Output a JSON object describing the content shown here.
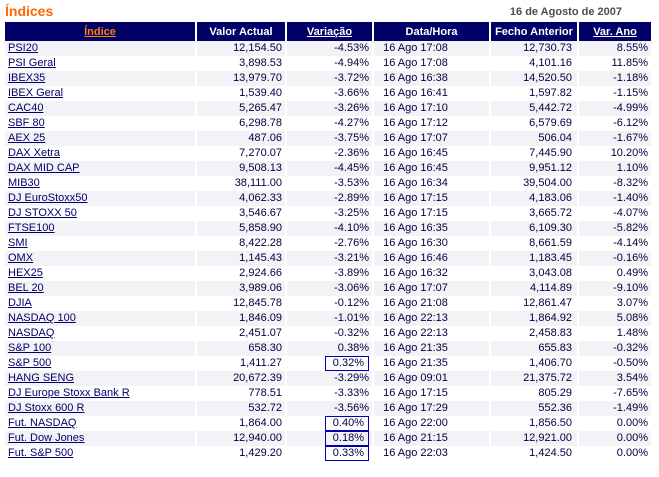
{
  "page": {
    "title": "Índices",
    "date": "16 de Agosto de 2007"
  },
  "colors": {
    "title_orange": "#FF6600",
    "header_bg": "#000066",
    "header_text": "#FFFFFF",
    "header_sort_link_orange": "#FF8000",
    "row_stripe": "#F2F2F7",
    "row_plain": "#FFFFFF",
    "cell_text": "#000040",
    "index_link": "#000066",
    "highlight_box_border": "#0000B0",
    "date_text": "#4D4D4D"
  },
  "table": {
    "columns": [
      "Índice",
      "Valor Actual",
      "Variação",
      "Data/Hora",
      "Fecho Anterior",
      "Var. Ano"
    ],
    "rows": [
      {
        "index": "PSI20",
        "valor_actual": "12,154.50",
        "variacao": "-4.53%",
        "data_hora": "16 Ago 17:08",
        "fecho_anterior": "12,730.73",
        "var_ano": "8.55%",
        "variacao_boxed": false
      },
      {
        "index": "PSI Geral",
        "valor_actual": "3,898.53",
        "variacao": "-4.94%",
        "data_hora": "16 Ago 17:08",
        "fecho_anterior": "4,101.16",
        "var_ano": "11.85%",
        "variacao_boxed": false
      },
      {
        "index": "IBEX35",
        "valor_actual": "13,979.70",
        "variacao": "-3.72%",
        "data_hora": "16 Ago 16:38",
        "fecho_anterior": "14,520.50",
        "var_ano": "-1.18%",
        "variacao_boxed": false
      },
      {
        "index": "IBEX Geral",
        "valor_actual": "1,539.40",
        "variacao": "-3.66%",
        "data_hora": "16 Ago 16:41",
        "fecho_anterior": "1,597.82",
        "var_ano": "-1.15%",
        "variacao_boxed": false
      },
      {
        "index": "CAC40",
        "valor_actual": "5,265.47",
        "variacao": "-3.26%",
        "data_hora": "16 Ago 17:10",
        "fecho_anterior": "5,442.72",
        "var_ano": "-4.99%",
        "variacao_boxed": false
      },
      {
        "index": "SBF 80",
        "valor_actual": "6,298.78",
        "variacao": "-4.27%",
        "data_hora": "16 Ago 17:12",
        "fecho_anterior": "6,579.69",
        "var_ano": "-6.12%",
        "variacao_boxed": false
      },
      {
        "index": "AEX 25",
        "valor_actual": "487.06",
        "variacao": "-3.75%",
        "data_hora": "16 Ago 17:07",
        "fecho_anterior": "506.04",
        "var_ano": "-1.67%",
        "variacao_boxed": false
      },
      {
        "index": "DAX Xetra",
        "valor_actual": "7,270.07",
        "variacao": "-2.36%",
        "data_hora": "16 Ago 16:45",
        "fecho_anterior": "7,445.90",
        "var_ano": "10.20%",
        "variacao_boxed": false
      },
      {
        "index": "DAX MID CAP",
        "valor_actual": "9,508.13",
        "variacao": "-4.45%",
        "data_hora": "16 Ago 16:45",
        "fecho_anterior": "9,951.12",
        "var_ano": "1.10%",
        "variacao_boxed": false
      },
      {
        "index": "MIB30",
        "valor_actual": "38,111.00",
        "variacao": "-3.53%",
        "data_hora": "16 Ago 16:34",
        "fecho_anterior": "39,504.00",
        "var_ano": "-8.32%",
        "variacao_boxed": false
      },
      {
        "index": "DJ EuroStoxx50",
        "valor_actual": "4,062.33",
        "variacao": "-2.89%",
        "data_hora": "16 Ago 17:15",
        "fecho_anterior": "4,183.06",
        "var_ano": "-1.40%",
        "variacao_boxed": false
      },
      {
        "index": "DJ STOXX 50",
        "valor_actual": "3,546.67",
        "variacao": "-3.25%",
        "data_hora": "16 Ago 17:15",
        "fecho_anterior": "3,665.72",
        "var_ano": "-4.07%",
        "variacao_boxed": false
      },
      {
        "index": "FTSE100",
        "valor_actual": "5,858.90",
        "variacao": "-4.10%",
        "data_hora": "16 Ago 16:35",
        "fecho_anterior": "6,109.30",
        "var_ano": "-5.82%",
        "variacao_boxed": false
      },
      {
        "index": "SMI",
        "valor_actual": "8,422.28",
        "variacao": "-2.76%",
        "data_hora": "16 Ago 16:30",
        "fecho_anterior": "8,661.59",
        "var_ano": "-4.14%",
        "variacao_boxed": false
      },
      {
        "index": "OMX",
        "valor_actual": "1,145.43",
        "variacao": "-3.21%",
        "data_hora": "16 Ago 16:46",
        "fecho_anterior": "1,183.45",
        "var_ano": "-0.16%",
        "variacao_boxed": false
      },
      {
        "index": "HEX25",
        "valor_actual": "2,924.66",
        "variacao": "-3.89%",
        "data_hora": "16 Ago 16:32",
        "fecho_anterior": "3,043.08",
        "var_ano": "0.49%",
        "variacao_boxed": false
      },
      {
        "index": "BEL 20",
        "valor_actual": "3,989.06",
        "variacao": "-3.06%",
        "data_hora": "16 Ago 17:07",
        "fecho_anterior": "4,114.89",
        "var_ano": "-9.10%",
        "variacao_boxed": false
      },
      {
        "index": "DJIA",
        "valor_actual": "12,845.78",
        "variacao": "-0.12%",
        "data_hora": "16 Ago 21:08",
        "fecho_anterior": "12,861.47",
        "var_ano": "3.07%",
        "variacao_boxed": false
      },
      {
        "index": "NASDAQ 100",
        "valor_actual": "1,846.09",
        "variacao": "-1.01%",
        "data_hora": "16 Ago 22:13",
        "fecho_anterior": "1,864.92",
        "var_ano": "5.08%",
        "variacao_boxed": false
      },
      {
        "index": "NASDAQ",
        "valor_actual": "2,451.07",
        "variacao": "-0.32%",
        "data_hora": "16 Ago 22:13",
        "fecho_anterior": "2,458.83",
        "var_ano": "1.48%",
        "variacao_boxed": false
      },
      {
        "index": "S&P 100",
        "valor_actual": "658.30",
        "variacao": "0.38%",
        "data_hora": "16 Ago 21:35",
        "fecho_anterior": "655.83",
        "var_ano": "-0.32%",
        "variacao_boxed": false
      },
      {
        "index": "S&P 500",
        "valor_actual": "1,411.27",
        "variacao": "0.32%",
        "data_hora": "16 Ago 21:35",
        "fecho_anterior": "1,406.70",
        "var_ano": "-0.50%",
        "variacao_boxed": true
      },
      {
        "index": "HANG SENG",
        "valor_actual": "20,672.39",
        "variacao": "-3.29%",
        "data_hora": "16 Ago 09:01",
        "fecho_anterior": "21,375.72",
        "var_ano": "3.54%",
        "variacao_boxed": false
      },
      {
        "index": "DJ Europe Stoxx Bank R",
        "valor_actual": "778.51",
        "variacao": "-3.33%",
        "data_hora": "16 Ago 17:15",
        "fecho_anterior": "805.29",
        "var_ano": "-7.65%",
        "variacao_boxed": false
      },
      {
        "index": "DJ Stoxx 600 R",
        "valor_actual": "532.72",
        "variacao": "-3.56%",
        "data_hora": "16 Ago 17:29",
        "fecho_anterior": "552.36",
        "var_ano": "-1.49%",
        "variacao_boxed": false
      },
      {
        "index": "Fut. NASDAQ",
        "valor_actual": "1,864.00",
        "variacao": "0.40%",
        "data_hora": "16 Ago 22:00",
        "fecho_anterior": "1,856.50",
        "var_ano": "0.00%",
        "variacao_boxed": true
      },
      {
        "index": "Fut. Dow Jones",
        "valor_actual": "12,940.00",
        "variacao": "0.18%",
        "data_hora": "16 Ago 21:15",
        "fecho_anterior": "12,921.00",
        "var_ano": "0.00%",
        "variacao_boxed": true
      },
      {
        "index": "Fut. S&P 500",
        "valor_actual": "1,429.20",
        "variacao": "0.33%",
        "data_hora": "16 Ago 22:03",
        "fecho_anterior": "1,424.50",
        "var_ano": "0.00%",
        "variacao_boxed": true
      }
    ]
  }
}
